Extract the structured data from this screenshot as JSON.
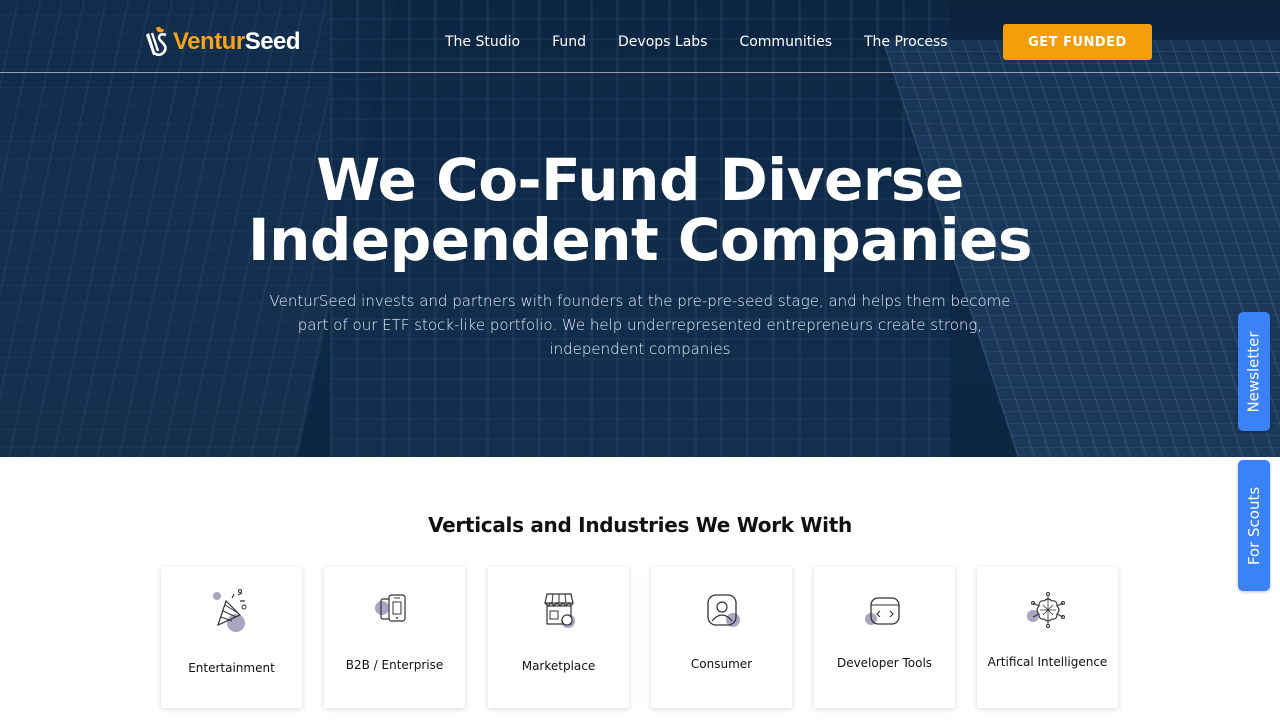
{
  "brand": {
    "name_part1": "Ventur",
    "name_part2": "Seed",
    "accent_color": "#f59e0b"
  },
  "nav": {
    "links": [
      "The Studio",
      "Fund",
      "Devops Labs",
      "Communities",
      "The Process"
    ],
    "cta_label": "GET FUNDED"
  },
  "hero": {
    "title_line1": "We Co-Fund Diverse",
    "title_line2": "Independent Companies",
    "subtitle": "VenturSeed invests and partners with founders at the pre-pre-seed stage, and helps them become part of our ETF stock-like portfolio. We help underrepresented entrepreneurs create strong, independent companies"
  },
  "side_tabs": {
    "newsletter": "Newsletter",
    "scouts": "For Scouts",
    "color": "#3b82f6"
  },
  "verticals": {
    "title": "Verticals and Industries We Work With",
    "items": [
      {
        "label": "Entertainment",
        "icon": "party-popper-icon"
      },
      {
        "label": "B2B / Enterprise",
        "icon": "devices-icon"
      },
      {
        "label": "Marketplace",
        "icon": "storefront-icon"
      },
      {
        "label": "Consumer",
        "icon": "user-profile-icon"
      },
      {
        "label": "Developer Tools",
        "icon": "code-window-icon"
      },
      {
        "label": "Artifical Intelligence",
        "icon": "neural-chip-icon"
      }
    ]
  }
}
